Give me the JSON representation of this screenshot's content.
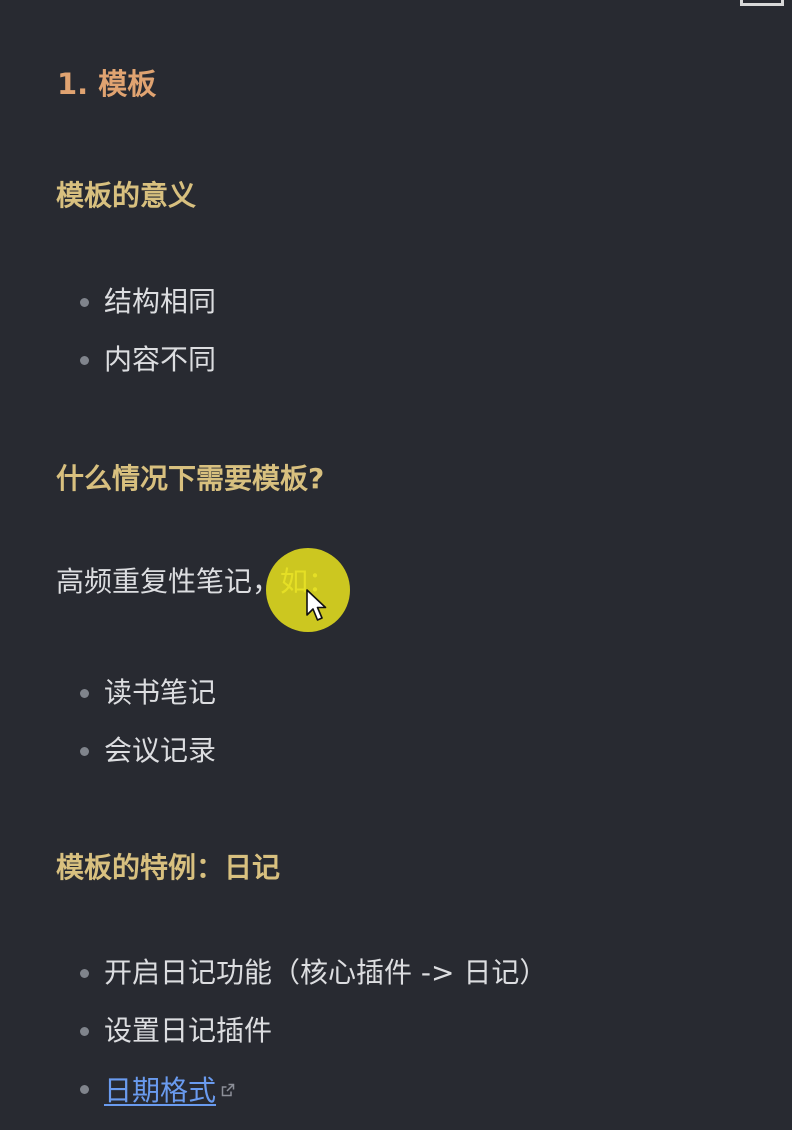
{
  "heading": "1. 模板",
  "sections": [
    {
      "title": "模板的意义",
      "items": [
        "结构相同",
        "内容不同"
      ]
    },
    {
      "title": "什么情况下需要模板?",
      "paragraph": {
        "text": "高频重复性笔记，",
        "highlight": "如："
      },
      "items": [
        "读书笔记",
        "会议记录"
      ]
    },
    {
      "title": "模板的特例：日记",
      "items": [
        "开启日记功能（核心插件 -> 日记）",
        "设置日记插件"
      ],
      "link_item": "日期格式"
    }
  ],
  "colors": {
    "background": "#282a31",
    "heading": "#e0a371",
    "subheading": "#d8c07f",
    "text": "#dcdde0",
    "link": "#6a9bef",
    "cursor_highlight": "#e2dd1e"
  },
  "icons": [
    "external-link-icon",
    "mouse-cursor-icon",
    "bullet-icon"
  ]
}
